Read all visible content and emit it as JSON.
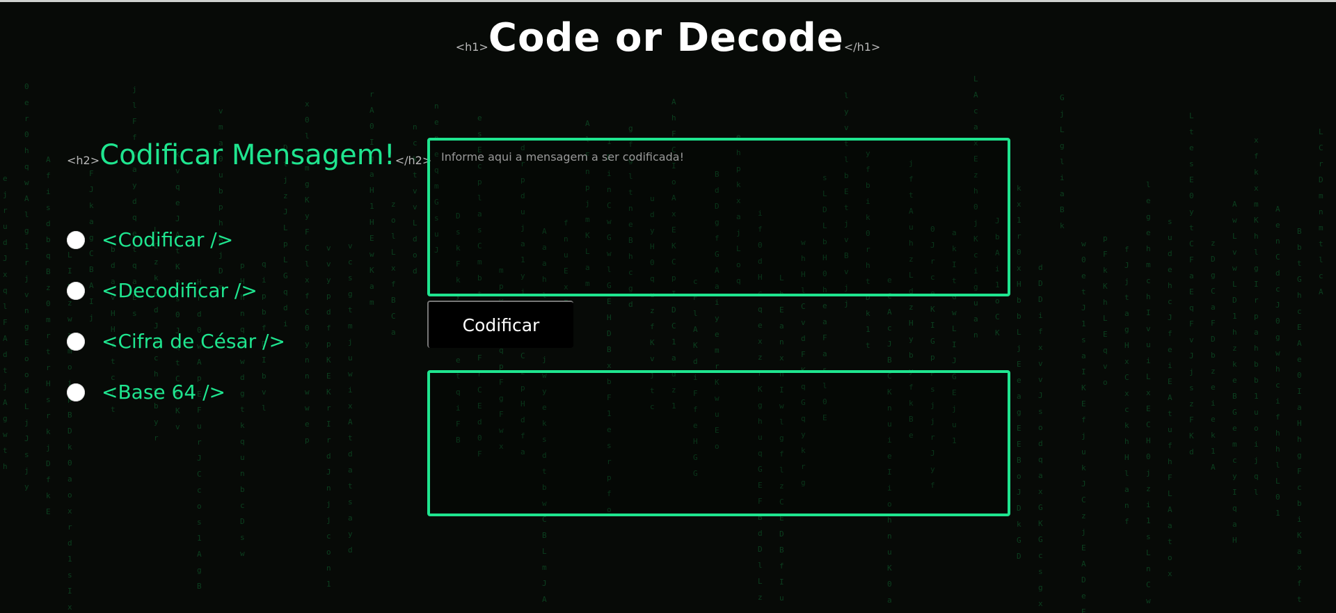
{
  "header": {
    "open_tag": "<h1>",
    "title": "Code or Decode",
    "close_tag": "</h1>"
  },
  "section": {
    "open_tag": "<h2>",
    "heading": "Codificar Mensagem!",
    "close_tag": "</h2>"
  },
  "options": [
    {
      "label": "<Codificar />"
    },
    {
      "label": "<Decodificar />"
    },
    {
      "label": "<Cifra de César />"
    },
    {
      "label": "<Base 64 />"
    }
  ],
  "input": {
    "placeholder": "Informe aqui a mensagem a ser codificada!",
    "value": ""
  },
  "action": {
    "button_label": "Codificar"
  },
  "output": {
    "value": ""
  },
  "colors": {
    "accent": "#1fe58f",
    "background": "#070a07",
    "matrix_text": "#0f6b32"
  }
}
